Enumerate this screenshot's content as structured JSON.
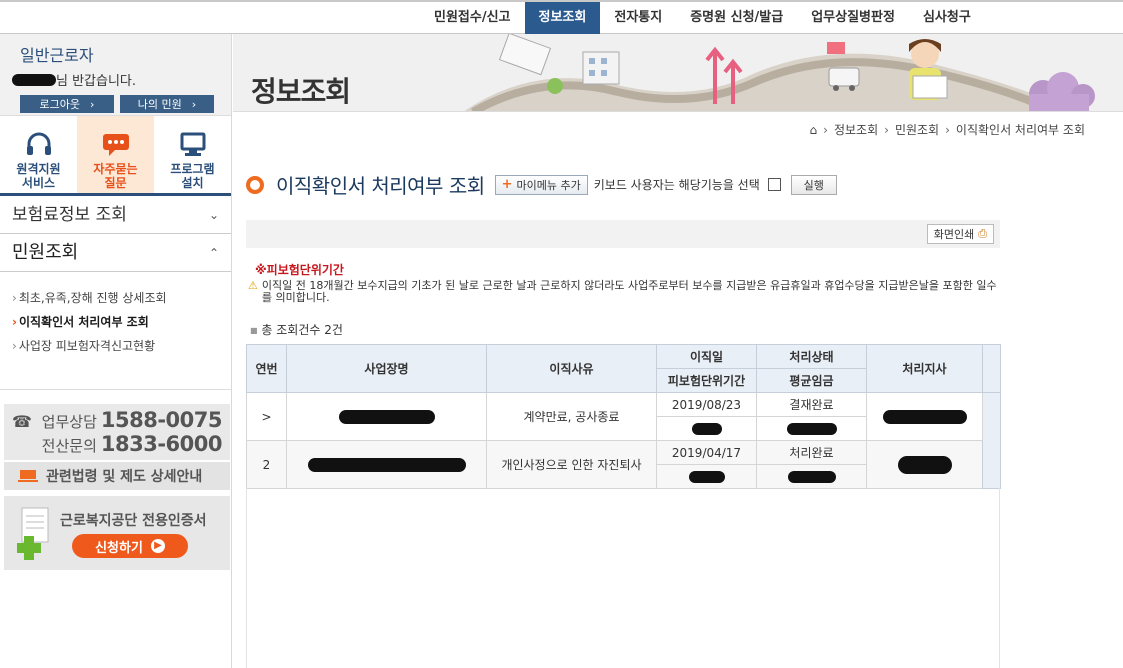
{
  "topnav": {
    "items": [
      "민원접수/신고",
      "정보조회",
      "전자통지",
      "증명원 신청/발급",
      "업무상질병판정",
      "심사청구"
    ],
    "active_index": 1
  },
  "user": {
    "type": "일반근로자",
    "greeting_suffix": "님 반갑습니다.",
    "logout": "로그아웃",
    "my_civil": "나의 민원"
  },
  "quick": {
    "remote": "원격지원\n서비스",
    "faq": "자주묻는\n질문",
    "program": "프로그램\n설치"
  },
  "sidemenu": {
    "insurance_info": "보험료정보 조회",
    "civil_inquiry": "민원조회",
    "sub_items": [
      "최초,유족,장해 진행 상세조회",
      "이직확인서 처리여부 조회",
      "사업장 피보험자격신고현황"
    ],
    "active_sub_index": 1
  },
  "contact": {
    "consult_label": "업무상담",
    "consult_number": "1588-0075",
    "it_label": "전산문의",
    "it_number": "1833-6000",
    "law_link": "관련법령 및 제도 상세안내",
    "cert_title": "근로복지공단 전용인증서",
    "cert_apply": "신청하기"
  },
  "banner": {
    "title": "정보조회"
  },
  "breadcrumb": [
    "정보조회",
    "민원조회",
    "이직확인서 처리여부 조회"
  ],
  "page": {
    "title": "이직확인서 처리여부 조회",
    "mymenu_add": "마이메뉴 추가",
    "keyboard_text": "키보드 사용자는 해당기능을 선택",
    "run": "실행",
    "print": "화면인쇄"
  },
  "notice": {
    "title": "※피보험단위기간",
    "text": "이직일 전 18개월간 보수지급의 기초가 된 날로 근로한 날과 근로하지 않더라도 사업주로부터 보수를 지급받은 유급휴일과 휴업수당을 지급받은날을 포함한 일수를 의미합니다."
  },
  "total": "총 조회건수 2건",
  "table": {
    "headers": {
      "no": "연번",
      "company": "사업장명",
      "reason": "이직사유",
      "leave_date": "이직일",
      "insured_period": "피보험단위기간",
      "status": "처리상태",
      "avg_wage": "평균임금",
      "branch": "처리지사"
    },
    "rows": [
      {
        "no": ">",
        "reason": "계약만료, 공사종료",
        "leave_date": "2019/08/23",
        "status": "결재완료"
      },
      {
        "no": "2",
        "reason": "개인사정으로 인한 자진퇴사",
        "leave_date": "2019/04/17",
        "status": "처리완료"
      }
    ]
  },
  "colors": {
    "nav_active": "#2b5b8e",
    "accent_orange": "#ef6b20",
    "title_navy": "#1b3a5e",
    "notice_red": "#c8161d"
  }
}
